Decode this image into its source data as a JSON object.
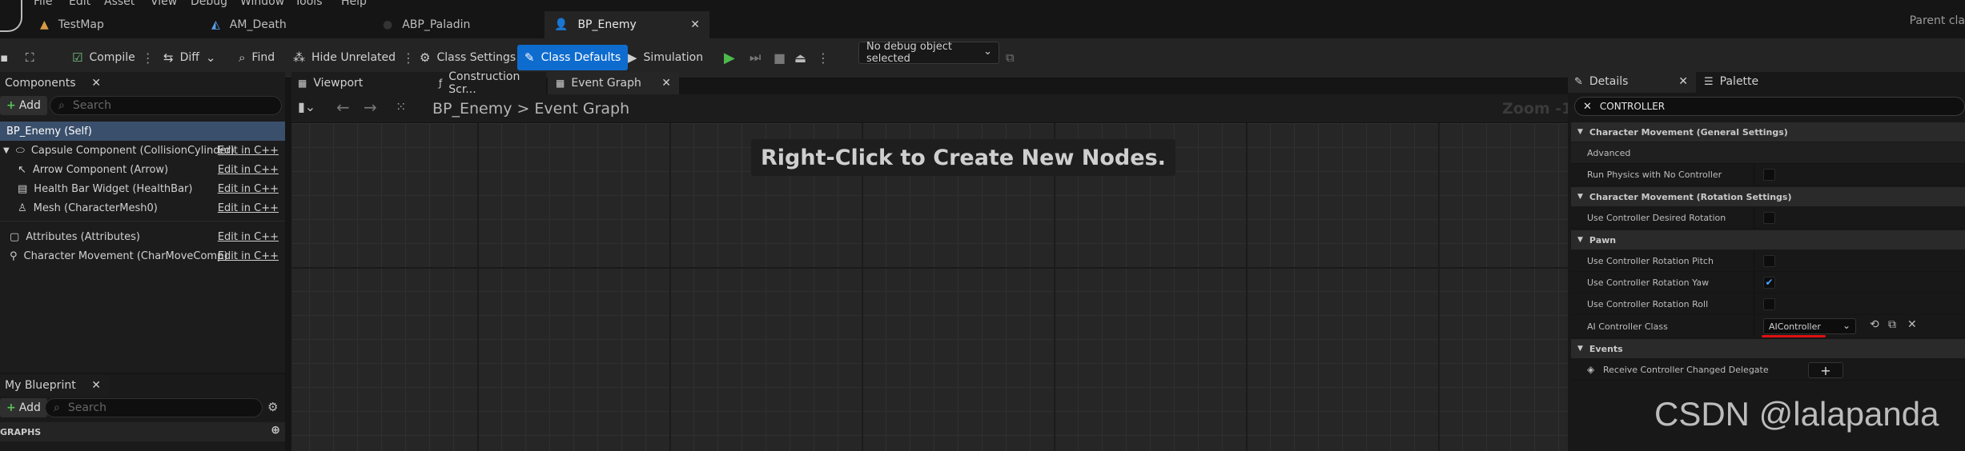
{
  "menu": [
    "File",
    "Edit",
    "Asset",
    "View",
    "Debug",
    "Window",
    "Tools",
    "Help"
  ],
  "tabs": [
    {
      "label": "TestMap",
      "active": false
    },
    {
      "label": "AM_Death",
      "active": false
    },
    {
      "label": "ABP_Paladin",
      "active": false
    },
    {
      "label": "BP_Enemy",
      "active": true
    }
  ],
  "parent_class": "Parent cla",
  "toolbar": {
    "compile": "Compile",
    "diff": "Diff",
    "find": "Find",
    "hide_unrelated": "Hide Unrelated",
    "class_settings": "Class Settings",
    "class_defaults": "Class Defaults",
    "simulation": "Simulation",
    "debug_select": "No debug object selected"
  },
  "components": {
    "tab": "Components",
    "add": "Add",
    "search_placeholder": "Search",
    "items": [
      {
        "label": "BP_Enemy (Self)",
        "edit": ""
      },
      {
        "label": "Capsule Component (CollisionCylinder)",
        "edit": "Edit in C++"
      },
      {
        "label": "Arrow Component (Arrow)",
        "edit": "Edit in C++"
      },
      {
        "label": "Health Bar Widget (HealthBar)",
        "edit": "Edit in C++"
      },
      {
        "label": "Mesh (CharacterMesh0)",
        "edit": "Edit in C++"
      },
      {
        "label": "Attributes (Attributes)",
        "edit": "Edit in C++"
      },
      {
        "label": "Character Movement (CharMoveComp)",
        "edit": "Edit in C++"
      }
    ]
  },
  "my_blueprint": {
    "tab": "My Blueprint",
    "add": "Add",
    "search_placeholder": "Search",
    "graphs": "GRAPHS"
  },
  "graph_tabs": [
    "Viewport",
    "Construction Scr...",
    "Event Graph"
  ],
  "breadcrumb": {
    "root": "BP_Enemy",
    "sep": ">",
    "leaf": "Event Graph"
  },
  "zoom": "Zoom -1",
  "graph_hint": "Right-Click to Create New Nodes.",
  "details": {
    "tab": "Details",
    "palette": "Palette",
    "search_value": "CONTROLLER",
    "sections": [
      {
        "title": "Character Movement (General Settings)"
      },
      {
        "title": "Character Movement (Rotation Settings)"
      },
      {
        "title": "Pawn"
      },
      {
        "title": "Events"
      }
    ],
    "advanced": "Advanced",
    "rows": {
      "run_physics": {
        "label": "Run Physics with No Controller",
        "checked": false
      },
      "desired_rotation": {
        "label": "Use Controller Desired Rotation",
        "checked": false
      },
      "pitch": {
        "label": "Use Controller Rotation Pitch",
        "checked": false
      },
      "yaw": {
        "label": "Use Controller Rotation Yaw",
        "checked": true
      },
      "roll": {
        "label": "Use Controller Rotation Roll",
        "checked": false
      },
      "ai_class": {
        "label": "AI Controller Class",
        "value": "AIController"
      },
      "receive": {
        "label": "Receive Controller Changed Delegate"
      }
    }
  },
  "watermark": "CSDN @lalapanda"
}
